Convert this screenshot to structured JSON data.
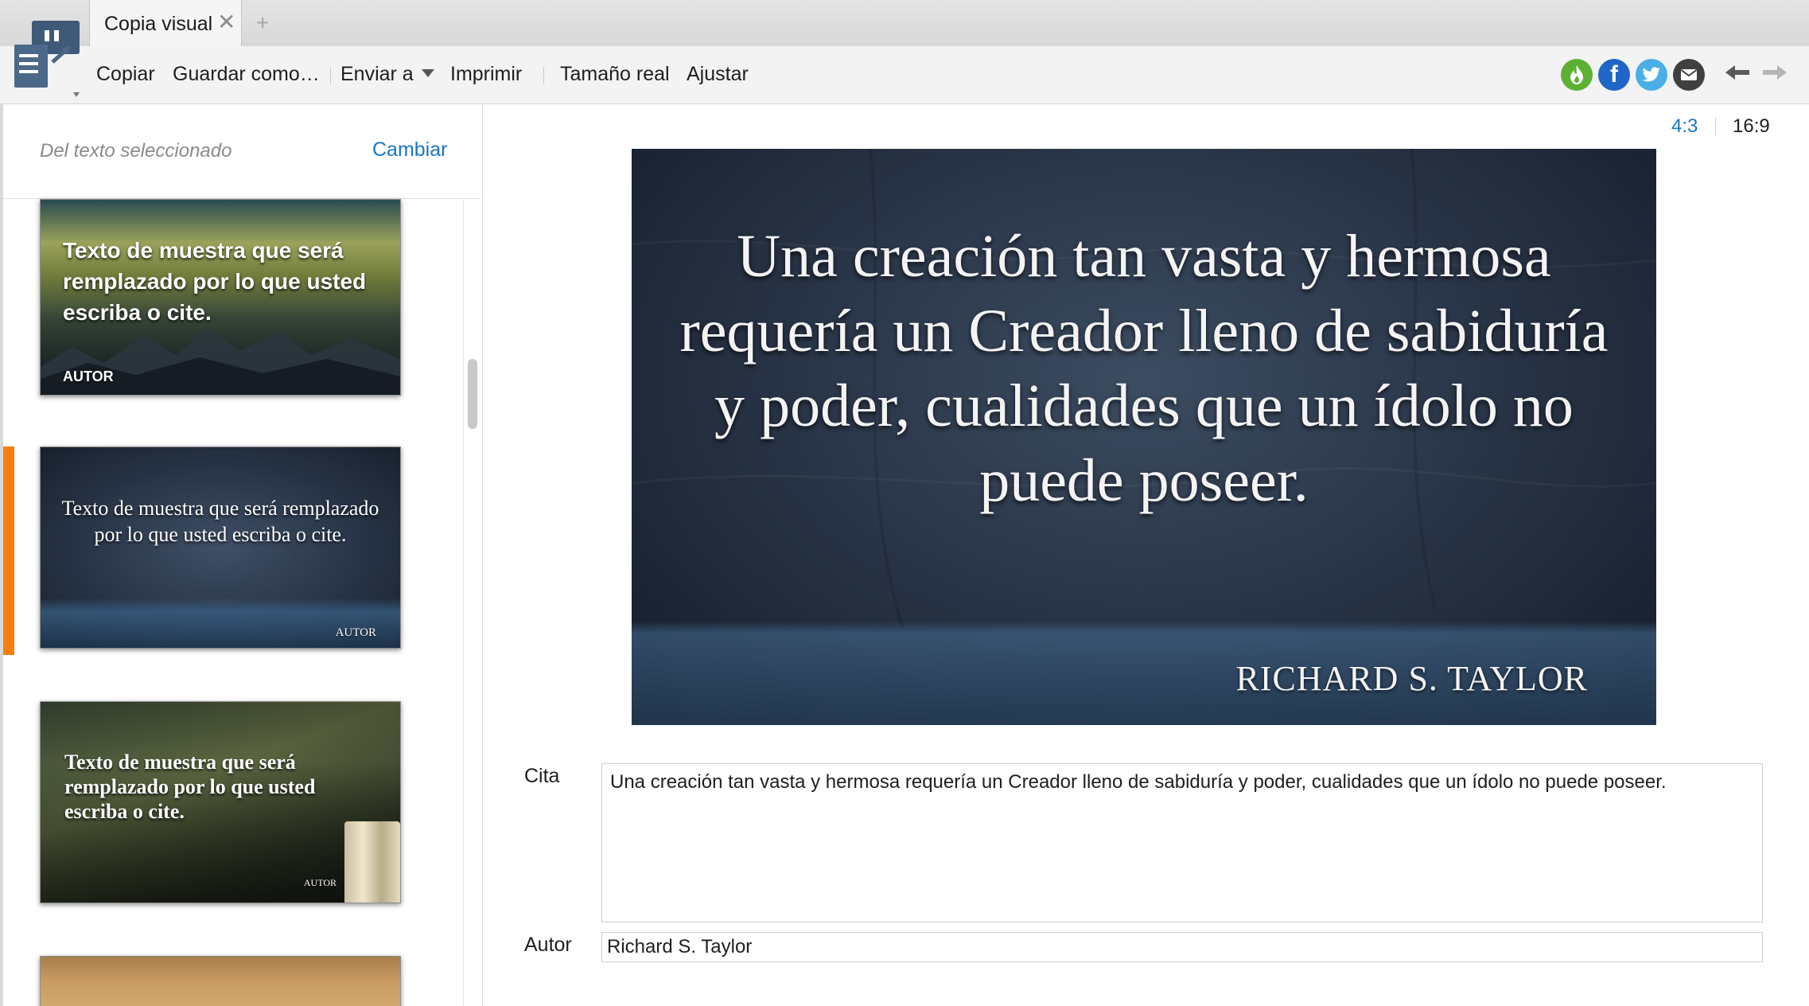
{
  "tab": {
    "title": "Copia visual",
    "close_glyph": "✕",
    "new_tab_glyph": "+"
  },
  "toolbar": {
    "copy_label": "Copiar",
    "save_as_label": "Guardar como…",
    "send_to_label": "Enviar a",
    "print_label": "Imprimir",
    "actual_size_label": "Tamaño real",
    "fit_label": "Ajustar",
    "share_icons": [
      "logos-share-icon",
      "facebook-icon",
      "twitter-icon",
      "email-icon"
    ],
    "back_arrow": "←",
    "forward_arrow": "→"
  },
  "left_panel": {
    "source_label": "Del texto seleccionado",
    "change_label": "Cambiar",
    "selected_index": 1,
    "thumbnails": [
      {
        "text": "Texto de muestra que será remplazado por lo que usted escriba o cite.",
        "author": "AUTOR"
      },
      {
        "text": "Texto de muestra que será remplazado por lo que usted escriba o cite.",
        "author": "AUTOR"
      },
      {
        "text": "Texto de muestra que será remplazado por lo que usted escriba o cite.",
        "author": "AUTOR"
      },
      {
        "text": "",
        "author": ""
      }
    ]
  },
  "main": {
    "ratio_4_3": "4:3",
    "ratio_16_9": "16:9",
    "preview": {
      "quote": "Una creación tan vasta y hermosa requería un Creador lleno de sabiduría y poder, cualidades que un ídolo no puede poseer.",
      "author": "RICHARD S. TAYLOR"
    },
    "quote_label": "Cita",
    "quote_value": "Una creación tan vasta y hermosa requería un Creador lleno de sabiduría y poder, cualidades que un ídolo no puede poseer.",
    "author_label": "Autor",
    "author_value": "Richard S. Taylor"
  },
  "colors": {
    "accent_link": "#1976c2",
    "selection_bar": "#f77f0f",
    "logos_green": "#5cb135",
    "facebook_blue": "#1f66c8",
    "twitter_blue": "#4aaee7",
    "email_gray": "#3f3f3f"
  }
}
